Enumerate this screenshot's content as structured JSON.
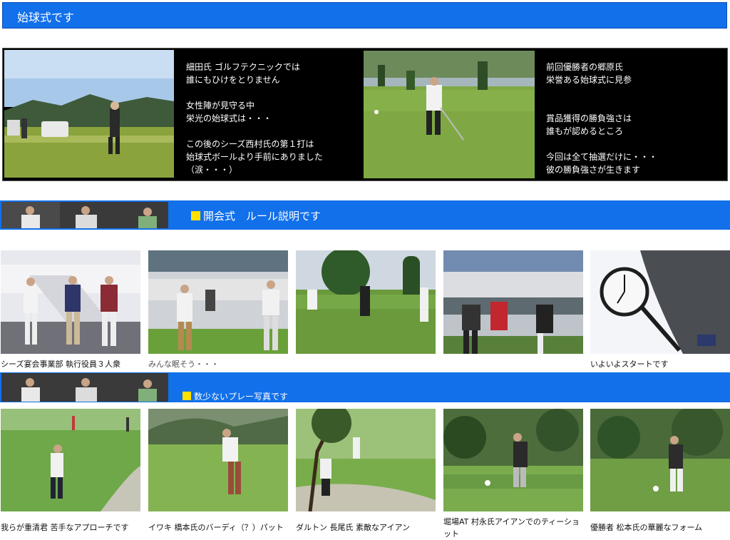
{
  "header": {
    "title": "始球式です"
  },
  "tee_off": {
    "left_text": "細田氏 ゴルフテクニックでは\n誰にもひけをとりません\n\n女性陣が見守る中\n栄光の始球式は・・・\n\nこの後のシーズ西村氏の第１打は\n始球式ボールより手前にありました\n（涙・・・）",
    "right_text": "前回優勝者の郷原氏\n栄誉ある始球式に見参\n\n\n賞品獲得の勝負強さは\n誰もが認めるところ\n\n今回は全て抽選だけに・・・\n彼の勝負強さが生きます"
  },
  "section_opening": {
    "title": "開会式　ルール説明です"
  },
  "opening_photos": [
    {
      "caption": "シーズ宴会事業部 執行役員３人衆"
    },
    {
      "caption": "みんな眠そう・・・"
    },
    {
      "caption": ""
    },
    {
      "caption": ""
    },
    {
      "caption": "いよいよスタートです"
    }
  ],
  "section_play": {
    "title": "数少ないプレー写真です"
  },
  "play_photos": [
    {
      "caption": "我らが重清君 苦手なアプローチです"
    },
    {
      "caption": "イワキ 橋本氏のバーディ（？）パット"
    },
    {
      "caption": "ダルトン 長尾氏 素敵なアイアン"
    },
    {
      "caption": "堀場AT 村永氏アイアンでのティーショット"
    },
    {
      "caption": "優勝者 松本氏の華麗なフォーム"
    }
  ],
  "colors": {
    "accent": "#1170ea",
    "marker": "#ffe000"
  }
}
